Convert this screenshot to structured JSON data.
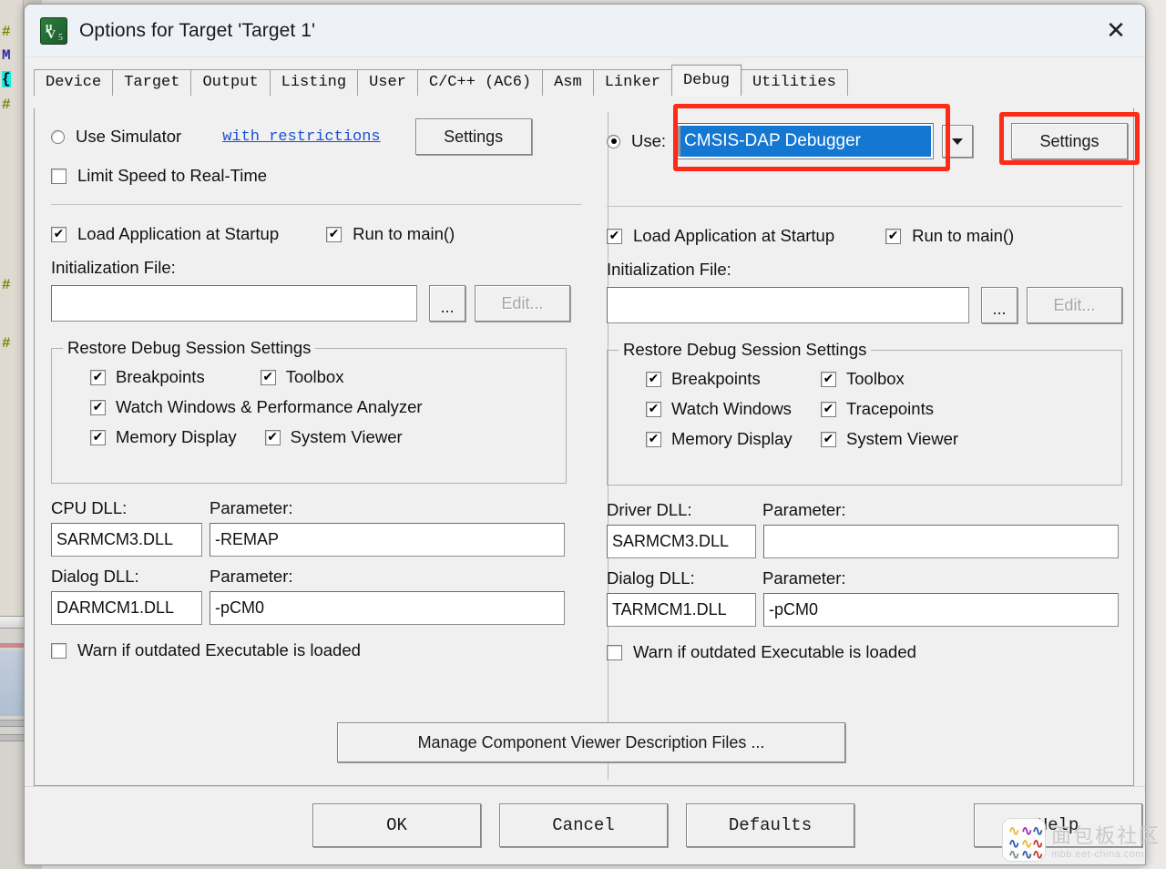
{
  "window": {
    "title": "Options for Target 'Target 1'",
    "icon": "keil-uvision-icon",
    "close_label": "✕"
  },
  "tabs": [
    {
      "label": "Device",
      "active": false
    },
    {
      "label": "Target",
      "active": false
    },
    {
      "label": "Output",
      "active": false
    },
    {
      "label": "Listing",
      "active": false
    },
    {
      "label": "User",
      "active": false
    },
    {
      "label": "C/C++ (AC6)",
      "active": false
    },
    {
      "label": "Asm",
      "active": false
    },
    {
      "label": "Linker",
      "active": false
    },
    {
      "label": "Debug",
      "active": true
    },
    {
      "label": "Utilities",
      "active": false
    }
  ],
  "left": {
    "use_simulator_label": "Use Simulator",
    "use_simulator_checked": false,
    "restrictions_link": "with restrictions",
    "settings_label": "Settings",
    "limit_speed_label": "Limit Speed to Real-Time",
    "limit_speed_checked": false,
    "load_app_label": "Load Application at Startup",
    "load_app_checked": true,
    "run_to_main_label": "Run to main()",
    "run_to_main_checked": true,
    "init_file_label": "Initialization File:",
    "init_file_value": "",
    "browse_label": "...",
    "edit_label": "Edit...",
    "edit_disabled": true,
    "restore_group_title": "Restore Debug Session Settings",
    "restore_items": [
      {
        "label": "Breakpoints",
        "checked": true
      },
      {
        "label": "Toolbox",
        "checked": true
      },
      {
        "label": "Watch Windows & Performance Analyzer",
        "checked": true
      },
      {
        "label": "Memory Display",
        "checked": true
      },
      {
        "label": "System Viewer",
        "checked": true
      }
    ],
    "cpu_dll_label": "CPU DLL:",
    "cpu_dll_value": "SARMCM3.DLL",
    "cpu_param_label": "Parameter:",
    "cpu_param_value": "-REMAP",
    "dialog_dll_label": "Dialog DLL:",
    "dialog_dll_value": "DARMCM1.DLL",
    "dialog_param_label": "Parameter:",
    "dialog_param_value": "-pCM0",
    "warn_label": "Warn if outdated Executable is loaded",
    "warn_checked": false
  },
  "right": {
    "use_label": "Use:",
    "use_checked": true,
    "driver_value": "CMSIS-DAP Debugger",
    "settings_label": "Settings",
    "load_app_label": "Load Application at Startup",
    "load_app_checked": true,
    "run_to_main_label": "Run to main()",
    "run_to_main_checked": true,
    "init_file_label": "Initialization File:",
    "init_file_value": "",
    "browse_label": "...",
    "edit_label": "Edit...",
    "edit_disabled": true,
    "restore_group_title": "Restore Debug Session Settings",
    "restore_items": [
      {
        "label": "Breakpoints",
        "checked": true
      },
      {
        "label": "Toolbox",
        "checked": true
      },
      {
        "label": "Watch Windows",
        "checked": true
      },
      {
        "label": "Tracepoints",
        "checked": true
      },
      {
        "label": "Memory Display",
        "checked": true
      },
      {
        "label": "System Viewer",
        "checked": true
      }
    ],
    "driver_dll_label": "Driver DLL:",
    "driver_dll_value": "SARMCM3.DLL",
    "driver_param_label": "Parameter:",
    "driver_param_value": "",
    "dialog_dll_label": "Dialog DLL:",
    "dialog_dll_value": "TARMCM1.DLL",
    "dialog_param_label": "Parameter:",
    "dialog_param_value": "-pCM0",
    "warn_label": "Warn if outdated Executable is loaded",
    "warn_checked": false
  },
  "manage_button_label": "Manage Component Viewer Description Files ...",
  "footer_buttons": [
    {
      "label": "OK",
      "name": "ok-button"
    },
    {
      "label": "Cancel",
      "name": "cancel-button"
    },
    {
      "label": "Defaults",
      "name": "defaults-button"
    },
    {
      "label": "Help",
      "name": "help-button"
    }
  ],
  "annotations": {
    "accent_color": "#fe2b16",
    "boxes": [
      "driver-combobox-highlight",
      "driver-settings-highlight"
    ]
  },
  "watermark": {
    "cn_text": "面包板社区",
    "en_text": "mbb.eet-china.com"
  },
  "background_code": [
    {
      "text": "#",
      "kind": "hash"
    },
    {
      "text": "M",
      "kind": "kw"
    },
    {
      "text": "{",
      "kind": "brace"
    },
    {
      "text": "#",
      "kind": "hash"
    },
    {
      "text": "#",
      "kind": "hash"
    },
    {
      "text": "#",
      "kind": "hash"
    }
  ]
}
